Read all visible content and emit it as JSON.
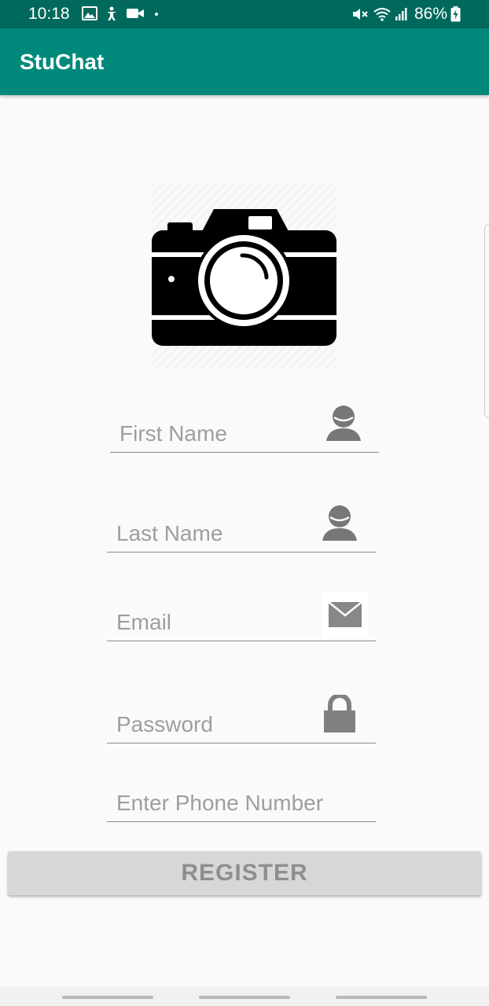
{
  "status_bar": {
    "time": "10:18",
    "battery": "86%",
    "icons": [
      "image-icon",
      "accessibility-icon",
      "video-icon",
      "dot-icon",
      "mute-icon",
      "wifi-icon",
      "signal-icon",
      "battery-charging-icon"
    ]
  },
  "app_bar": {
    "title": "StuChat"
  },
  "profile_image": {
    "icon": "camera-icon"
  },
  "form": {
    "first_name": {
      "placeholder": "First Name",
      "value": "",
      "icon": "person-icon"
    },
    "last_name": {
      "placeholder": "Last Name",
      "value": "",
      "icon": "person-icon"
    },
    "email": {
      "placeholder": "Email",
      "value": "",
      "icon": "email-icon"
    },
    "password": {
      "placeholder": "Password",
      "value": "",
      "icon": "lock-icon"
    },
    "phone": {
      "placeholder": "Enter Phone Number",
      "value": ""
    }
  },
  "register_button": {
    "label": "REGISTER"
  },
  "colors": {
    "primary": "#00897b",
    "primary_dark": "#00695c",
    "background": "#fafafa",
    "button_disabled": "#d6d7d7",
    "button_text": "#8e8e8e",
    "icon_gray": "#757575"
  }
}
